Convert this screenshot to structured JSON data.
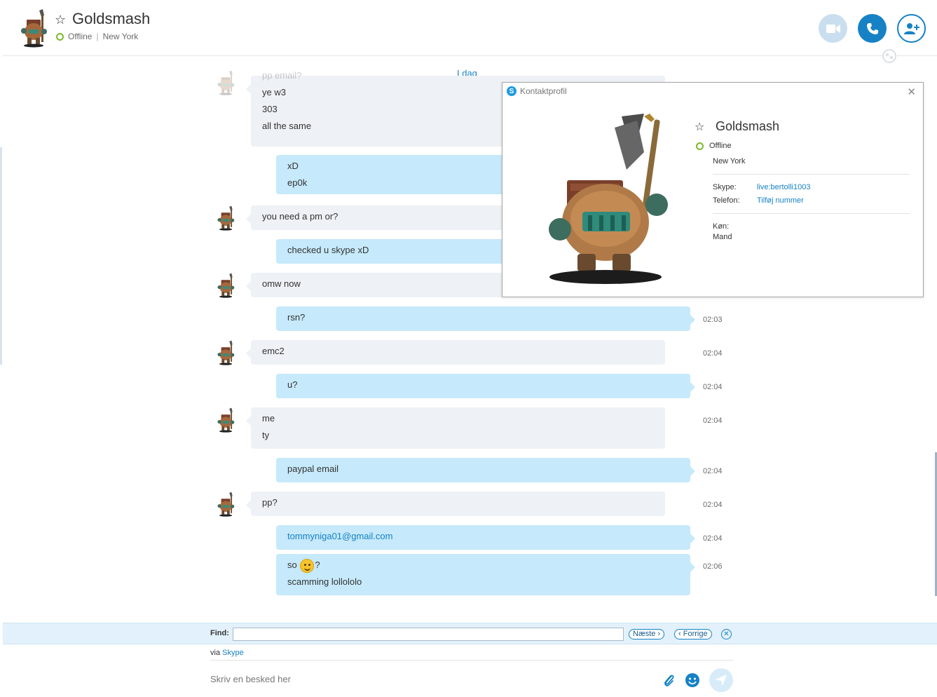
{
  "header": {
    "contact_name": "Goldsmash",
    "status": "Offline",
    "separator": "|",
    "location": "New York",
    "actions": [
      "video-call",
      "audio-call",
      "add-people"
    ]
  },
  "chat": {
    "day_label": "I dag",
    "messages": [
      {
        "dir": "in",
        "lines": [
          "pp email?",
          "ye w3",
          "303",
          "all the same"
        ],
        "time": ""
      },
      {
        "dir": "out",
        "lines": [
          "xD",
          "ep0k"
        ],
        "time": ""
      },
      {
        "dir": "in",
        "lines": [
          "you need a pm or?"
        ],
        "time": ""
      },
      {
        "dir": "out",
        "lines": [
          "checked u skype xD"
        ],
        "time": ""
      },
      {
        "dir": "in",
        "lines": [
          "omw now"
        ],
        "time": ""
      },
      {
        "dir": "out",
        "lines": [
          "rsn?"
        ],
        "time": "02:03"
      },
      {
        "dir": "in",
        "lines": [
          "emc2"
        ],
        "time": "02:04"
      },
      {
        "dir": "out",
        "lines": [
          "u?"
        ],
        "time": "02:04"
      },
      {
        "dir": "in",
        "lines": [
          "me",
          "ty"
        ],
        "time": "02:04"
      },
      {
        "dir": "out",
        "lines": [
          "paypal email"
        ],
        "time": "02:04"
      },
      {
        "dir": "in",
        "lines": [
          "pp?"
        ],
        "time": "02:04"
      },
      {
        "dir": "out",
        "lines": [
          "tommyniga01@gmail.com"
        ],
        "time": "02:04"
      },
      {
        "dir": "out",
        "lines": [
          "so",
          "?",
          "scamming lollololo"
        ],
        "time": "02:06"
      }
    ]
  },
  "profile": {
    "title": "Kontaktprofil",
    "name": "Goldsmash",
    "status": "Offline",
    "location": "New York",
    "skype_label": "Skype:",
    "skype_value": "live:bertolli1003",
    "phone_label": "Telefon:",
    "phone_value": "Tilføj nummer",
    "gender_label": "Køn:",
    "gender_value": "Mand"
  },
  "find": {
    "label": "Find:",
    "value": "",
    "next": "Næste",
    "prev": "Forrige"
  },
  "compose": {
    "via_prefix": "via",
    "via_link": "Skype",
    "placeholder": "Skriv en besked her"
  },
  "colors": {
    "accent": "#1682c5",
    "incoming_bubble": "#eef1f5",
    "outgoing_bubble": "#c6e9fb",
    "offline_dot": "#7cbb2c"
  }
}
